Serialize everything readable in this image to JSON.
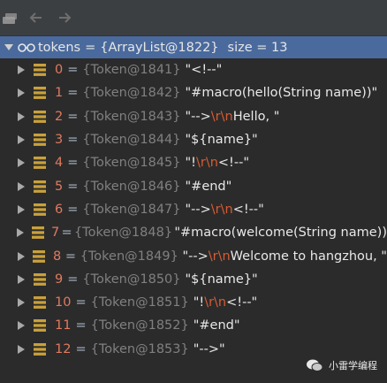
{
  "root": {
    "name": "tokens",
    "eq": "=",
    "value": "{ArrayList@1822}",
    "size_label": "size = 13"
  },
  "tokens": [
    {
      "index": "0",
      "ref": "{Token@1841}",
      "parts": [
        {
          "t": "\"<!--\"",
          "esc": false
        }
      ]
    },
    {
      "index": "1",
      "ref": "{Token@1842}",
      "parts": [
        {
          "t": "\"#macro(hello(String name))\"",
          "esc": false
        }
      ]
    },
    {
      "index": "2",
      "ref": "{Token@1843}",
      "parts": [
        {
          "t": "\"-->",
          "esc": false
        },
        {
          "t": "\\r\\n",
          "esc": true
        },
        {
          "t": "Hello, \"",
          "esc": false
        }
      ]
    },
    {
      "index": "3",
      "ref": "{Token@1844}",
      "parts": [
        {
          "t": "\"${name}\"",
          "esc": false
        }
      ]
    },
    {
      "index": "4",
      "ref": "{Token@1845}",
      "parts": [
        {
          "t": "\"!",
          "esc": false
        },
        {
          "t": "\\r\\n",
          "esc": true
        },
        {
          "t": "<!--\"",
          "esc": false
        }
      ]
    },
    {
      "index": "5",
      "ref": "{Token@1846}",
      "parts": [
        {
          "t": "\"#end\"",
          "esc": false
        }
      ]
    },
    {
      "index": "6",
      "ref": "{Token@1847}",
      "parts": [
        {
          "t": "\"-->",
          "esc": false
        },
        {
          "t": "\\r\\n",
          "esc": true
        },
        {
          "t": "<!--\"",
          "esc": false
        }
      ]
    },
    {
      "index": "7",
      "ref": "{Token@1848}",
      "parts": [
        {
          "t": "\"#macro(welcome(String name))",
          "esc": false
        }
      ]
    },
    {
      "index": "8",
      "ref": "{Token@1849}",
      "parts": [
        {
          "t": "\"-->",
          "esc": false
        },
        {
          "t": "\\r\\n",
          "esc": true
        },
        {
          "t": "Welcome to hangzhou, \"",
          "esc": false
        }
      ]
    },
    {
      "index": "9",
      "ref": "{Token@1850}",
      "parts": [
        {
          "t": "\"${name}\"",
          "esc": false
        }
      ]
    },
    {
      "index": "10",
      "ref": "{Token@1851}",
      "parts": [
        {
          "t": "\"!",
          "esc": false
        },
        {
          "t": "\\r\\n",
          "esc": true
        },
        {
          "t": "<!--\"",
          "esc": false
        }
      ]
    },
    {
      "index": "11",
      "ref": "{Token@1852}",
      "parts": [
        {
          "t": "\"#end\"",
          "esc": false
        }
      ]
    },
    {
      "index": "12",
      "ref": "{Token@1853}",
      "parts": [
        {
          "t": "\"-->\"",
          "esc": false
        }
      ]
    }
  ],
  "eq_sign": "=",
  "watermark": {
    "text": "小雷学编程"
  },
  "icons": {
    "layers": "layers-icon",
    "back": "back-arrow-icon",
    "forward": "forward-arrow-icon",
    "expand": "expand-triangle-icon",
    "collapse": "collapse-triangle-icon",
    "watch": "watch-glasses-icon",
    "field": "field-icon",
    "wechat": "wechat-icon"
  },
  "colors": {
    "selected_row": "#4a6a9d",
    "index": "#e07a5f",
    "escape": "#d75b33",
    "ref": "#808080",
    "field_icon": "#c9a13b"
  }
}
